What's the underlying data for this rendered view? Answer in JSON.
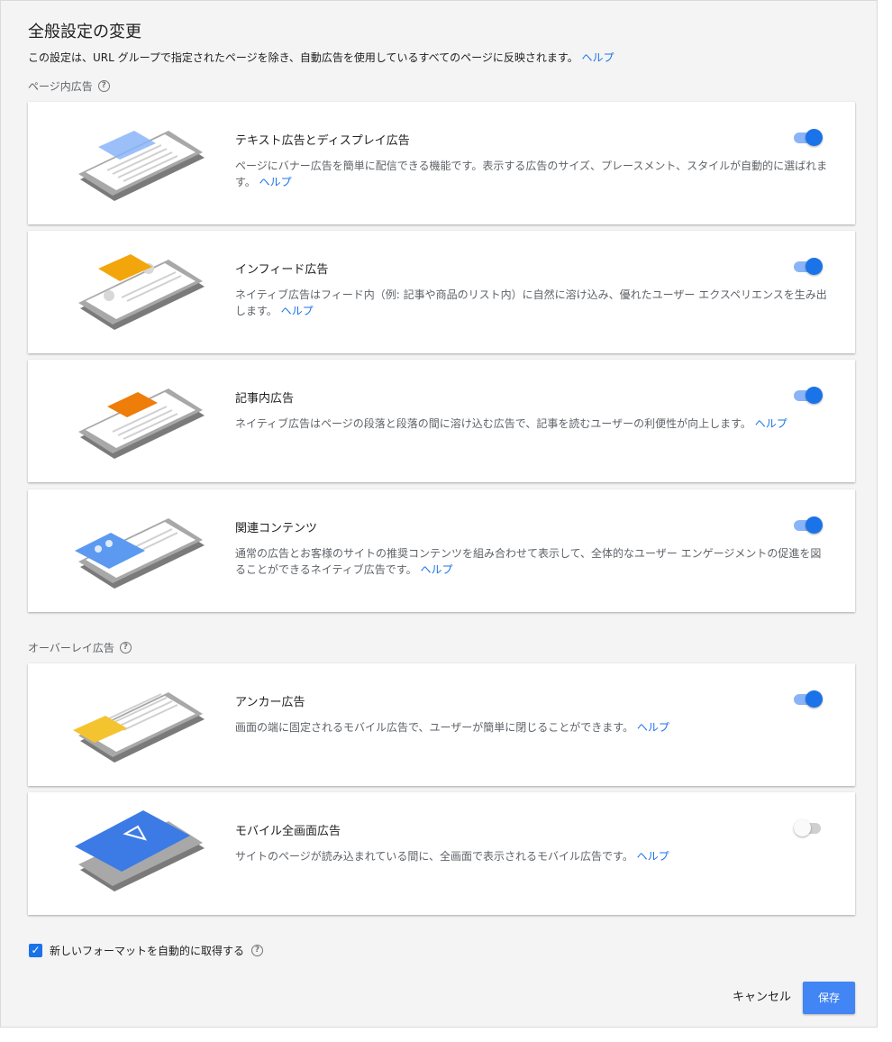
{
  "dialog": {
    "title": "全般設定の変更",
    "subtitle": "この設定は、URL グループで指定されたページを除き、自動広告を使用しているすべてのページに反映されます。",
    "subtitle_link": "ヘルプ"
  },
  "sections": {
    "in_page_label": "ページ内広告",
    "overlay_label": "オーバーレイ広告"
  },
  "help_icon_glyph": "?",
  "cards": [
    {
      "title": "テキスト広告とディスプレイ広告",
      "desc": "ページにバナー広告を簡単に配信できる機能です。表示する広告のサイズ、プレースメント、スタイルが自動的に選ばれます。",
      "link": "ヘルプ",
      "enabled": true,
      "illus_color": "#8ab4f8"
    },
    {
      "title": "インフィード広告",
      "desc": "ネイティブ広告はフィード内（例: 記事や商品のリスト内）に自然に溶け込み、優れたユーザー エクスペリエンスを生み出します。",
      "link": "ヘルプ",
      "enabled": true,
      "illus_color": "#f2a60c"
    },
    {
      "title": "記事内広告",
      "desc": "ネイティブ広告はページの段落と段落の間に溶け込む広告で、記事を読むユーザーの利便性が向上します。",
      "link": "ヘルプ",
      "enabled": true,
      "illus_color": "#ee7d0a"
    },
    {
      "title": "関連コンテンツ",
      "desc": "通常の広告とお客様のサイトの推奨コンテンツを組み合わせて表示して、全体的なユーザー エンゲージメントの促進を図ることができるネイティブ広告です。",
      "link": "ヘルプ",
      "enabled": true,
      "illus_color": "#5b9af0"
    },
    {
      "title": "アンカー広告",
      "desc": "画面の端に固定されるモバイル広告で、ユーザーが簡単に閉じることができます。",
      "link": "ヘルプ",
      "enabled": true,
      "illus_color": "#f4c430"
    },
    {
      "title": "モバイル全画面広告",
      "desc": "サイトのページが読み込まれている間に、全画面で表示されるモバイル広告です。",
      "link": "ヘルプ",
      "enabled": false,
      "illus_color": "#3c7be6"
    }
  ],
  "auto_formats": {
    "label": "新しいフォーマットを自動的に取得する",
    "checked": true,
    "check_glyph": "✓"
  },
  "buttons": {
    "cancel": "キャンセル",
    "save": "保存"
  },
  "colors": {
    "accent": "#1a73e8",
    "toggle_track_on": "#8ab4f8",
    "save_button": "#4285f4",
    "link": "#1a73e8"
  }
}
